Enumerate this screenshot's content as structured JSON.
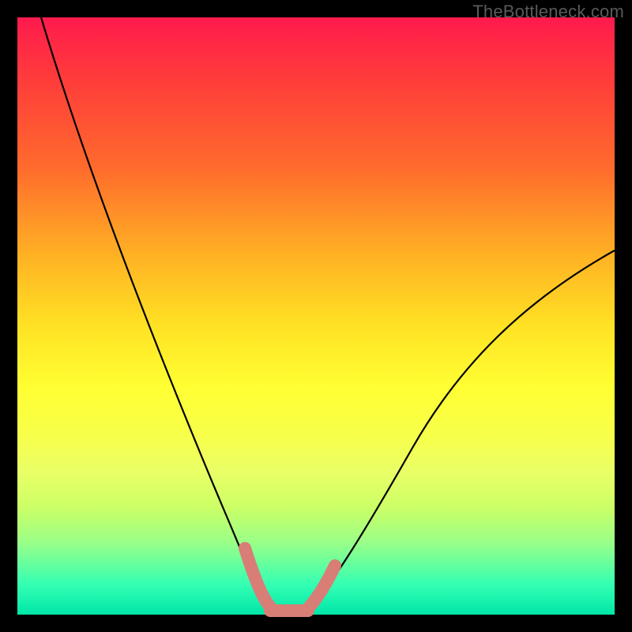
{
  "watermark": "TheBottleneck.com",
  "chart_data": {
    "type": "line",
    "title": "",
    "xlabel": "",
    "ylabel": "",
    "xlim": [
      0,
      100
    ],
    "ylim": [
      0,
      100
    ],
    "grid": false,
    "x": [
      4,
      8,
      12,
      16,
      20,
      24,
      28,
      32,
      36,
      38,
      40,
      42,
      44,
      46,
      48,
      50,
      54,
      60,
      66,
      72,
      78,
      84,
      90,
      96,
      100
    ],
    "y": [
      99,
      90,
      81,
      72,
      63,
      53,
      43,
      32,
      20,
      13,
      6,
      2,
      1,
      1,
      1,
      3,
      9,
      18,
      26,
      34,
      41,
      47,
      53,
      58,
      61
    ],
    "series": [
      {
        "name": "bottleneck-curve",
        "color": "#000000"
      },
      {
        "name": "minimum-highlight",
        "color": "#d97d77"
      }
    ],
    "background_gradient": {
      "top": "#ff1a4d",
      "upper_mid": "#ffe324",
      "lower_mid": "#ffff33",
      "bottom": "#00e6a8"
    }
  }
}
